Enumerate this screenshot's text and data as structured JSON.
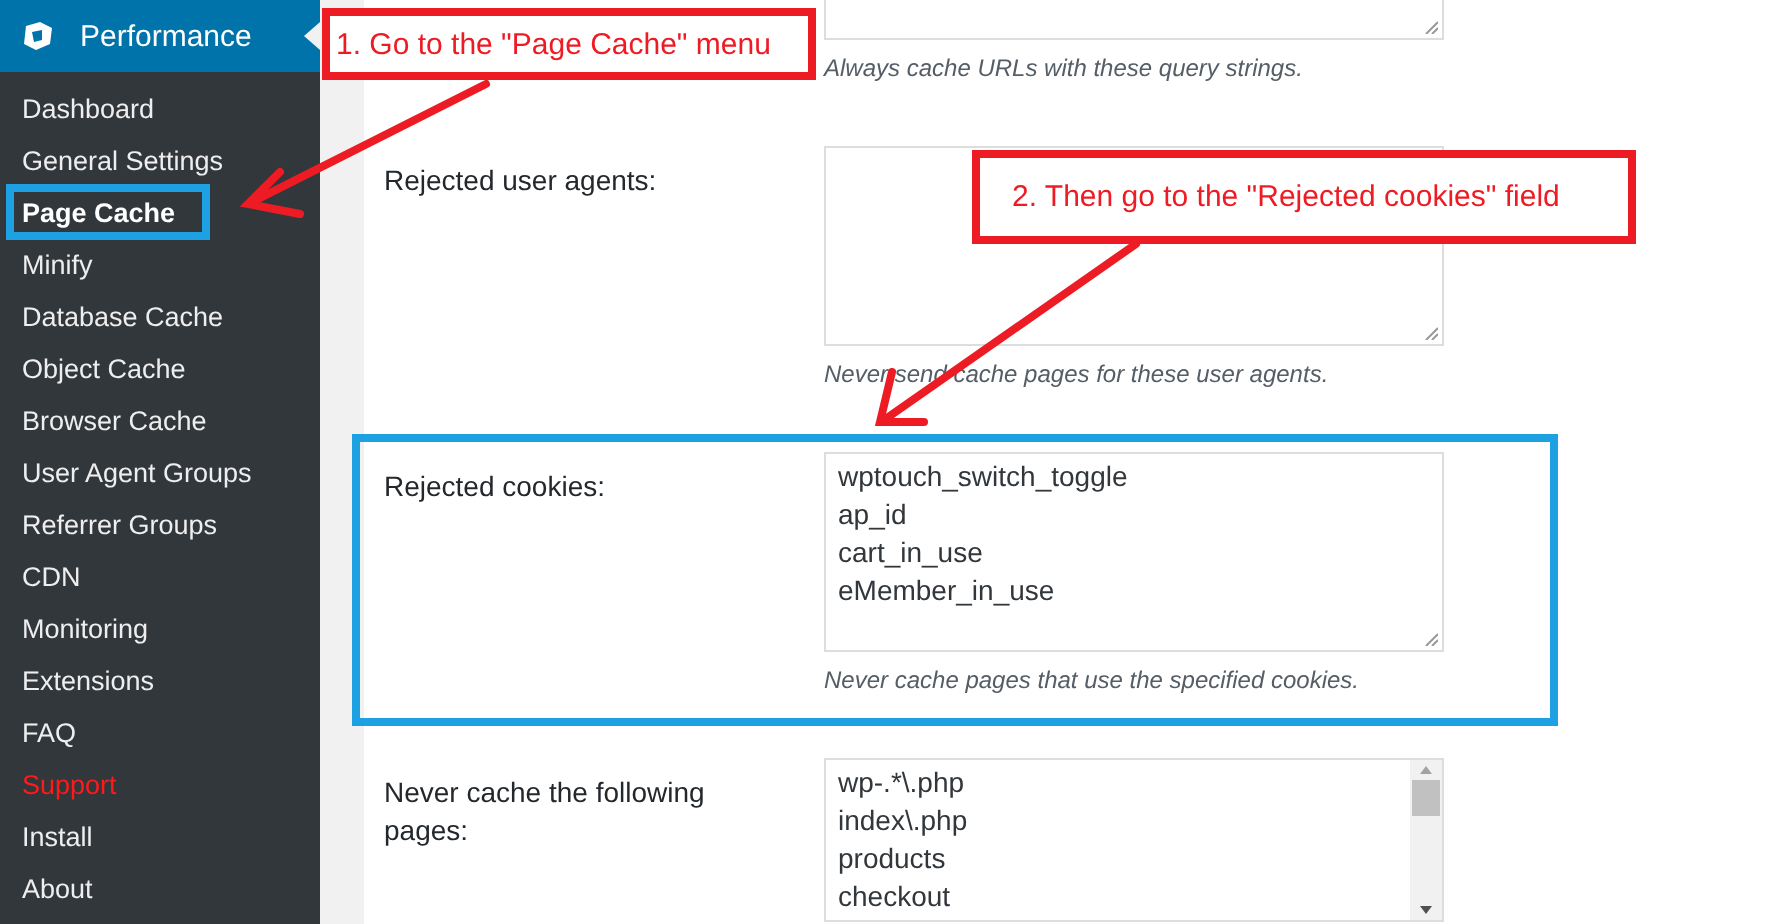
{
  "sidebar": {
    "title": "Performance",
    "items": [
      {
        "label": "Dashboard",
        "selected": false,
        "highlighted": false,
        "color": "#eeeeee"
      },
      {
        "label": "General Settings",
        "selected": false,
        "highlighted": false,
        "color": "#eeeeee"
      },
      {
        "label": "Page Cache",
        "selected": true,
        "highlighted": true,
        "color": "#ffffff"
      },
      {
        "label": "Minify",
        "selected": false,
        "highlighted": false,
        "color": "#eeeeee"
      },
      {
        "label": "Database Cache",
        "selected": false,
        "highlighted": false,
        "color": "#eeeeee"
      },
      {
        "label": "Object Cache",
        "selected": false,
        "highlighted": false,
        "color": "#eeeeee"
      },
      {
        "label": "Browser Cache",
        "selected": false,
        "highlighted": false,
        "color": "#eeeeee"
      },
      {
        "label": "User Agent Groups",
        "selected": false,
        "highlighted": false,
        "color": "#eeeeee"
      },
      {
        "label": "Referrer Groups",
        "selected": false,
        "highlighted": false,
        "color": "#eeeeee"
      },
      {
        "label": "CDN",
        "selected": false,
        "highlighted": false,
        "color": "#eeeeee"
      },
      {
        "label": "Monitoring",
        "selected": false,
        "highlighted": false,
        "color": "#eeeeee"
      },
      {
        "label": "Extensions",
        "selected": false,
        "highlighted": false,
        "color": "#eeeeee"
      },
      {
        "label": "FAQ",
        "selected": false,
        "highlighted": false,
        "color": "#eeeeee"
      },
      {
        "label": "Support",
        "selected": false,
        "highlighted": false,
        "color": "#ff1a1a"
      },
      {
        "label": "Install",
        "selected": false,
        "highlighted": false,
        "color": "#eeeeee"
      },
      {
        "label": "About",
        "selected": false,
        "highlighted": false,
        "color": "#eeeeee"
      }
    ]
  },
  "settings": [
    {
      "kind": "partial",
      "highlighted": false,
      "description": "Always cache URLs with these query strings."
    },
    {
      "kind": "textarea",
      "label": "Rejected user agents:",
      "highlighted": false,
      "description": "Never send cache pages for these user agents."
    },
    {
      "kind": "textarea",
      "label": "Rejected cookies:",
      "highlighted": true,
      "lines": [
        "wptouch_switch_toggle",
        "ap_id",
        "cart_in_use",
        "eMember_in_use"
      ],
      "description": "Never cache pages that use the specified cookies."
    },
    {
      "kind": "scrolling",
      "label": "Never cache the following pages:",
      "highlighted": false,
      "lines": [
        "wp-.*\\.php",
        "index\\.php",
        "products",
        "checkout"
      ]
    }
  ],
  "annotations": [
    "1. Go to the \"Page Cache\" menu",
    "2. Then go to the \"Rejected cookies\" field"
  ]
}
